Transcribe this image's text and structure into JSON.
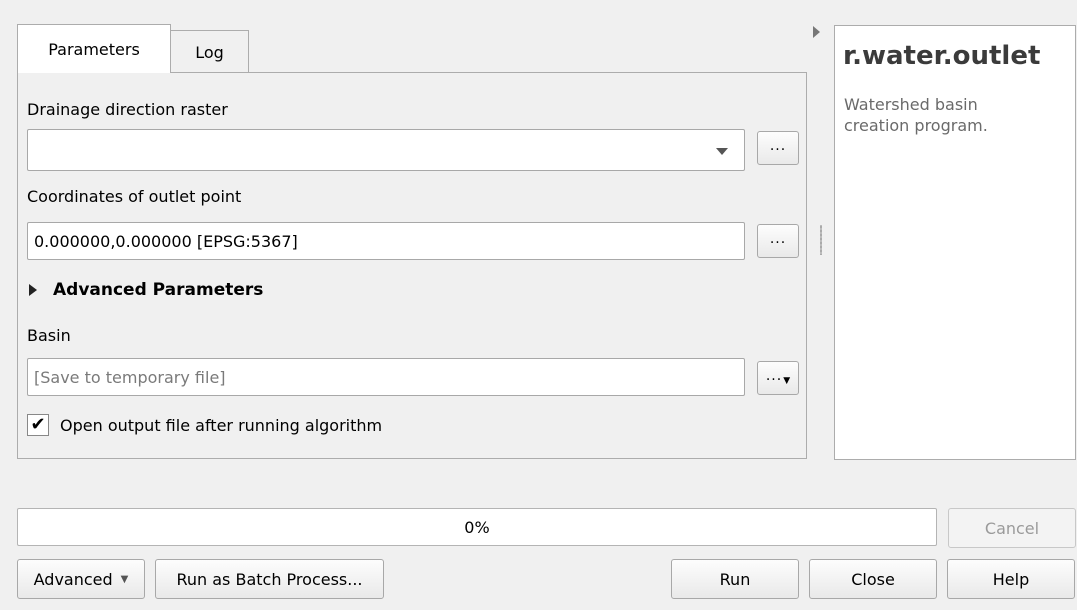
{
  "tabs": [
    {
      "label": "Parameters",
      "active": true
    },
    {
      "label": "Log",
      "active": false
    }
  ],
  "params": {
    "drainage_label": "Drainage direction raster",
    "drainage_value": "",
    "coordinates_label": "Coordinates of outlet point",
    "coordinates_value": "0.000000,0.000000 [EPSG:5367]",
    "advanced_label": "Advanced Parameters",
    "basin_label": "Basin",
    "basin_placeholder": "[Save to temporary file]",
    "open_output_label": "Open output file after running algorithm",
    "open_output_checked": true,
    "browse_label": "..."
  },
  "help": {
    "title": "r.water.outlet",
    "description": "Watershed basin creation program."
  },
  "progress": {
    "value": 0,
    "text": "0%"
  },
  "buttons": {
    "cancel": "Cancel",
    "advanced": "Advanced",
    "batch": "Run as Batch Process...",
    "run": "Run",
    "close": "Close",
    "help": "Help"
  },
  "icons": {
    "checkmark": "✔"
  }
}
